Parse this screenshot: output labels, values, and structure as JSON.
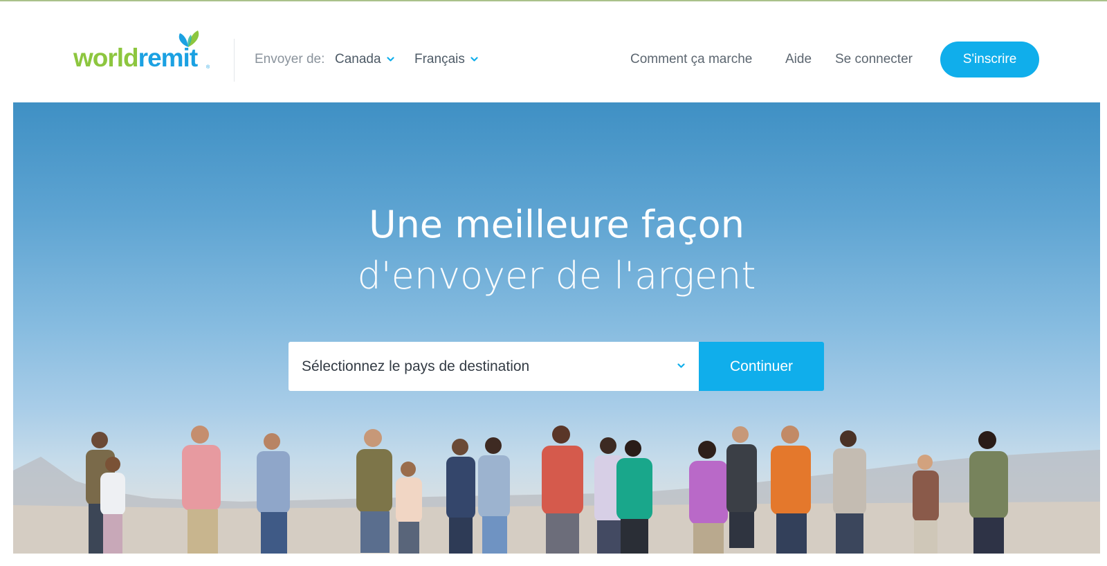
{
  "brand": {
    "name_part1": "world",
    "name_part2": "remit",
    "colors": {
      "green": "#8dc63f",
      "blue": "#1ba1e2",
      "accent": "#10aeeb"
    }
  },
  "header": {
    "send_from_label": "Envoyer de:",
    "country": "Canada",
    "language": "Français",
    "nav": {
      "how_it_works": "Comment ça marche",
      "help": "Aide",
      "login": "Se connecter"
    },
    "signup_label": "S'inscrire"
  },
  "hero": {
    "title_line1": "Une meilleure façon",
    "title_line2": "d'envoyer de l'argent",
    "destination_placeholder": "Sélectionnez le pays de destination",
    "continue_label": "Continuer"
  },
  "icons": {
    "logo_mark": "butterfly-leaf-icon",
    "dropdown": "chevron-down-icon"
  }
}
